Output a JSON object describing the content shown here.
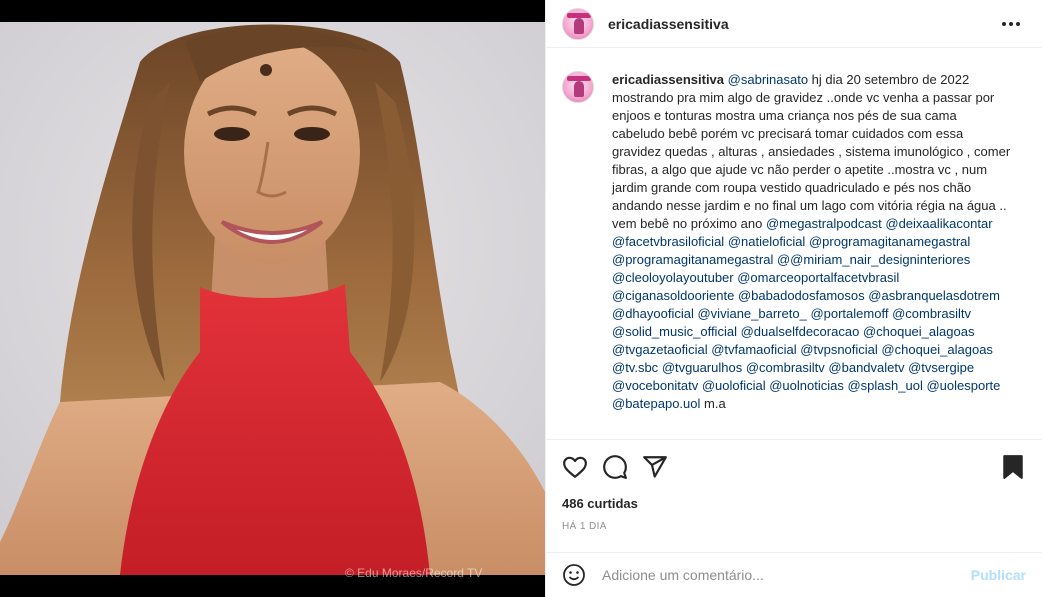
{
  "post": {
    "author": "ericadiassensitiva",
    "image_credit": "© Edu Moraes/Record TV"
  },
  "caption": {
    "username": "ericadiassensitiva",
    "first_mention": "@sabrinasato",
    "text_1": " hj dia 20 setembro de 2022 mostrando pra mim algo de gravidez ..onde vc venha a passar por enjoos e tonturas mostra uma criança nos pés de sua cama cabeludo bebê porém vc precisará tomar cuidados com essa gravidez quedas , alturas , ansiedades , sistema imunológico , comer fibras, a algo que ajude vc não perder o apetite ..mostra vc , num jardim grande com roupa vestido quadriculado e pés nos chão andando nesse jardim e no final um lago com vitória régia na água .. vem bebê no próximo ano ",
    "mentions": [
      "@megastralpodcast",
      "@deixaalikacontar",
      "@facetvbrasiloficial",
      "@natieloficial",
      "@programagitanamegastral",
      "@programagitanamegastral",
      "@",
      "@miriam_nair_designinteriores",
      "@cleoloyolayoutuber",
      "@omarceoportalfacetvbrasil",
      "@ciganasoldooriente",
      "@babadodosfamosos",
      "@asbranquelasdotrem",
      "@dhayooficial",
      "@viviane_barreto_",
      "@portalemoff",
      "@combrasiltv",
      "@solid_music_official",
      "@dualselfdecoracao",
      "@choquei_alagoas",
      "@tvgazetaoficial",
      "@tvfamaoficial",
      "@tvpsnoficial",
      "@choquei_alagoas",
      "@tv.sbc",
      "@tvguarulhos",
      "@combrasiltv",
      "@bandvaletv",
      "@tvsergipe",
      "@vocebonitatv",
      "@uoloficial",
      "@uolnoticias",
      "@splash_uol",
      "@uolesporte",
      "@batepapo.uol"
    ],
    "ending": " m.a"
  },
  "actions": {
    "like_icon": "heart-icon",
    "comment_icon": "comment-icon",
    "share_icon": "paper-plane-icon",
    "save_icon": "bookmark-icon"
  },
  "likes_label": "486 curtidas",
  "time_label": "HÁ 1 DIA",
  "composer": {
    "placeholder": "Adicione um comentário...",
    "publish_label": "Publicar"
  },
  "colors": {
    "mention": "#00376b",
    "publish_disabled": "#b2dffc",
    "dress_red": "#d8262e"
  }
}
